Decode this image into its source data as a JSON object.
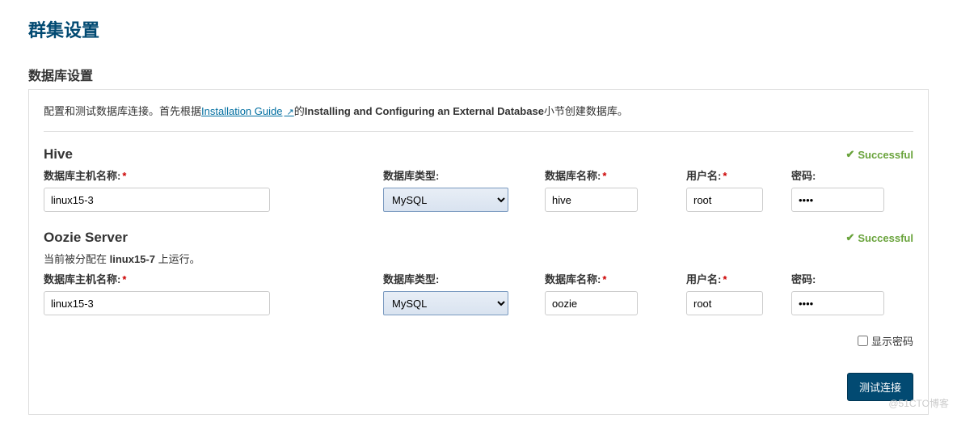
{
  "page_title": "群集设置",
  "section_title": "数据库设置",
  "instruction": {
    "pre": "配置和测试数据库连接。首先根据",
    "link": "Installation Guide",
    "mid": "的",
    "bold": "Installing and Configuring an External Database",
    "post": "小节创建数据库。"
  },
  "labels": {
    "host": "数据库主机名称:",
    "type": "数据库类型:",
    "name": "数据库名称:",
    "user": "用户名:",
    "pass": "密码:",
    "successful": "Successful",
    "show_password": "显示密码",
    "test_connection": "测试连接"
  },
  "services": [
    {
      "title": "Hive",
      "note": "",
      "host": "linux15-3",
      "type": "MySQL",
      "name": "hive",
      "user": "root",
      "pass": "••••",
      "success": true
    },
    {
      "title": "Oozie Server",
      "note_pre": "当前被分配在 ",
      "note_bold": "linux15-7",
      "note_post": " 上运行。",
      "host": "linux15-3",
      "type": "MySQL",
      "name": "oozie",
      "user": "root",
      "pass": "••••",
      "success": true
    }
  ],
  "watermark": "@51CTO博客"
}
